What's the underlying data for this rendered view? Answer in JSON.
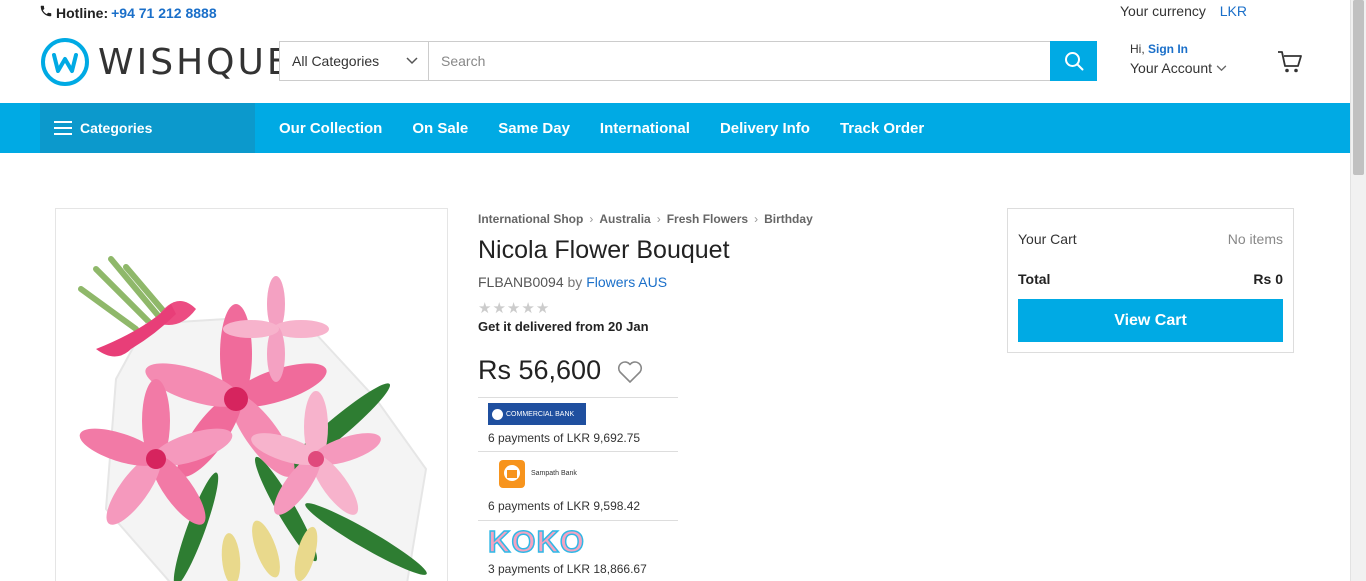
{
  "topbar": {
    "hotline_label": "Hotline:",
    "hotline_number": "+94 71 212 8888",
    "currency_label": "Your currency",
    "currency_value": "LKR"
  },
  "brand": {
    "name": "WISHQUE",
    "accent": "#00aae4",
    "link_color": "#1a6fc9"
  },
  "search": {
    "category": "All Categories",
    "placeholder": "Search"
  },
  "account": {
    "greeting": "Hi,",
    "sign_in": "Sign In",
    "label": "Your Account"
  },
  "nav": {
    "categories": "Categories",
    "links": [
      "Our Collection",
      "On Sale",
      "Same Day",
      "International",
      "Delivery Info",
      "Track Order"
    ]
  },
  "breadcrumb": [
    "International Shop",
    "Australia",
    "Fresh Flowers",
    "Birthday"
  ],
  "product": {
    "title": "Nicola Flower Bouquet",
    "sku": "FLBANB0094",
    "by": "by",
    "seller": "Flowers AUS",
    "rating_stars": 0,
    "delivery": "Get it delivered from 20 Jan",
    "price": "Rs 56,600"
  },
  "payment_plans": [
    {
      "bank": "COMMERCIAL BANK",
      "text": "6 payments of LKR 9,692.75"
    },
    {
      "bank": "Sampath Bank",
      "text": "6 payments of LKR 9,598.42"
    },
    {
      "bank": "KOKO",
      "text": "3 payments of LKR 18,866.67"
    }
  ],
  "cart": {
    "title": "Your Cart",
    "items": "No items",
    "total_label": "Total",
    "total_value": "Rs 0",
    "button": "View Cart"
  }
}
